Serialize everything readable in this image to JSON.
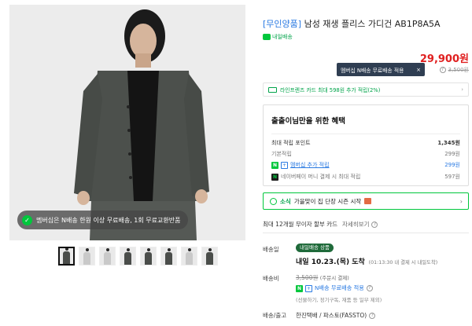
{
  "product": {
    "brand": "[무인양품]",
    "name": " 남성 재생 플리스 가디건 AB1P8A5A",
    "tag": "내일배송",
    "price": "29,900원",
    "original_price": "3,500원",
    "tooltip": "멤버십 N배송 무료배송 적용",
    "tooltip_close": "×"
  },
  "image": {
    "promo": "멤버십은 N배송 한원 이상 무료배송, 1회 무료교환반품",
    "thumb_count": 8
  },
  "card_offer": "라인프렌즈 카드 최대 598원 추가 적립(2%)",
  "benefit": {
    "heading": "출출이님만을 위한 혜택",
    "max_points_label": "최대 적립 포인트",
    "max_points_value": "1,345원",
    "basic_label": "기본적립",
    "basic_value": "299원",
    "membership_label": "멤버십 추가 적립",
    "membership_value": "299원",
    "npay_label": "네이버페이 머니 결제 시 최대 적립",
    "npay_value": "597원"
  },
  "season": {
    "prefix": "소식",
    "text": "가을맞이 집 단장 시즌 시작"
  },
  "installment": {
    "text": "최대 12개월 무이자 할부 카드",
    "more": "자세히보기"
  },
  "shipping": {
    "label_day": "배송일",
    "badge": "내일배송 상품",
    "arrive": "내일 10.23.(목) 도착",
    "arrive_sub": "(01:13:30 내 결제 시 내일도착)",
    "label_fee": "배송비",
    "fee_strike": "3,500원",
    "fee_note": "(주문시 결제)",
    "member_text": "N배송 무료배송 적용",
    "member_note": "(선물하기, 정기구독, 재품 등 일부 제외)",
    "label_carrier": "배송/출고",
    "carrier": "한진택배 / 파스토(FASSTO)"
  }
}
